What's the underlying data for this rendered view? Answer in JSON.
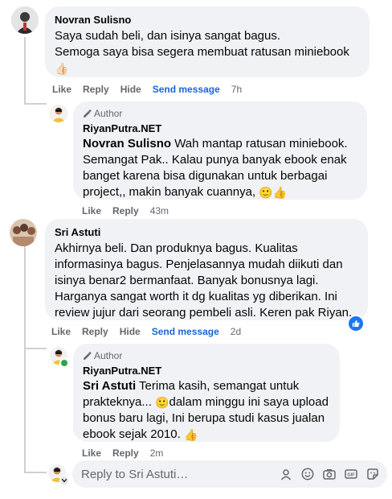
{
  "comments": [
    {
      "author": "Novran Sulisno",
      "lines": [
        "Saya sudah beli, dan isinya sangat bagus.",
        "Semoga saya bisa segera membuat ratusan miniebook"
      ],
      "emoji": "👍🏻",
      "actions": {
        "like": "Like",
        "reply": "Reply",
        "hide": "Hide",
        "send": "Send message",
        "time": "7h"
      },
      "reply": {
        "badge": "Author",
        "author": "RiyanPutra.NET",
        "mention": "Novran Sulisno",
        "lines": [
          " Wah mantap ratusan miniebook.",
          "Semangat Pak.. Kalau punya banyak ebook enak",
          "banget karena bisa digunakan untuk berbagai",
          "project,, makin banyak cuannya, "
        ],
        "emoji": "🙂👍",
        "actions": {
          "like": "Like",
          "reply": "Reply",
          "time": "43m"
        }
      }
    },
    {
      "author": "Sri Astuti",
      "lines": [
        "Akhirnya beli. Dan produknya bagus. Kualitas",
        "informasinya bagus. Penjelasannya mudah diikuti dan",
        "isinya benar2 bermanfaat. Banyak bonusnya lagi.",
        "Harganya sangat worth it dg kualitas yg diberikan. Ini",
        "review jujur dari seorang pembeli asli. Keren pak Riyan."
      ],
      "actions": {
        "like": "Like",
        "reply": "Reply",
        "hide": "Hide",
        "send": "Send message",
        "time": "2d"
      },
      "reply": {
        "badge": "Author",
        "author": "RiyanPutra.NET",
        "mention": "Sri Astuti",
        "lines": [
          " Terima kasih, semangat untuk",
          "prakteknya... ",
          "dalam minggu ini saya upload",
          "bonus baru lagi, Ini berupa studi kasus jualan",
          "ebook sejak 2010. "
        ],
        "emoji1": "🙂",
        "emoji2": "👍",
        "actions": {
          "like": "Like",
          "reply": "Reply",
          "time": "2m"
        }
      }
    }
  ],
  "reply_box": {
    "placeholder": "Reply to Sri Astuti…"
  },
  "colors": {
    "link": "#1a65d6",
    "bubble": "#f0f2f5",
    "muted": "#65676b",
    "like_badge": "#1877f2"
  }
}
